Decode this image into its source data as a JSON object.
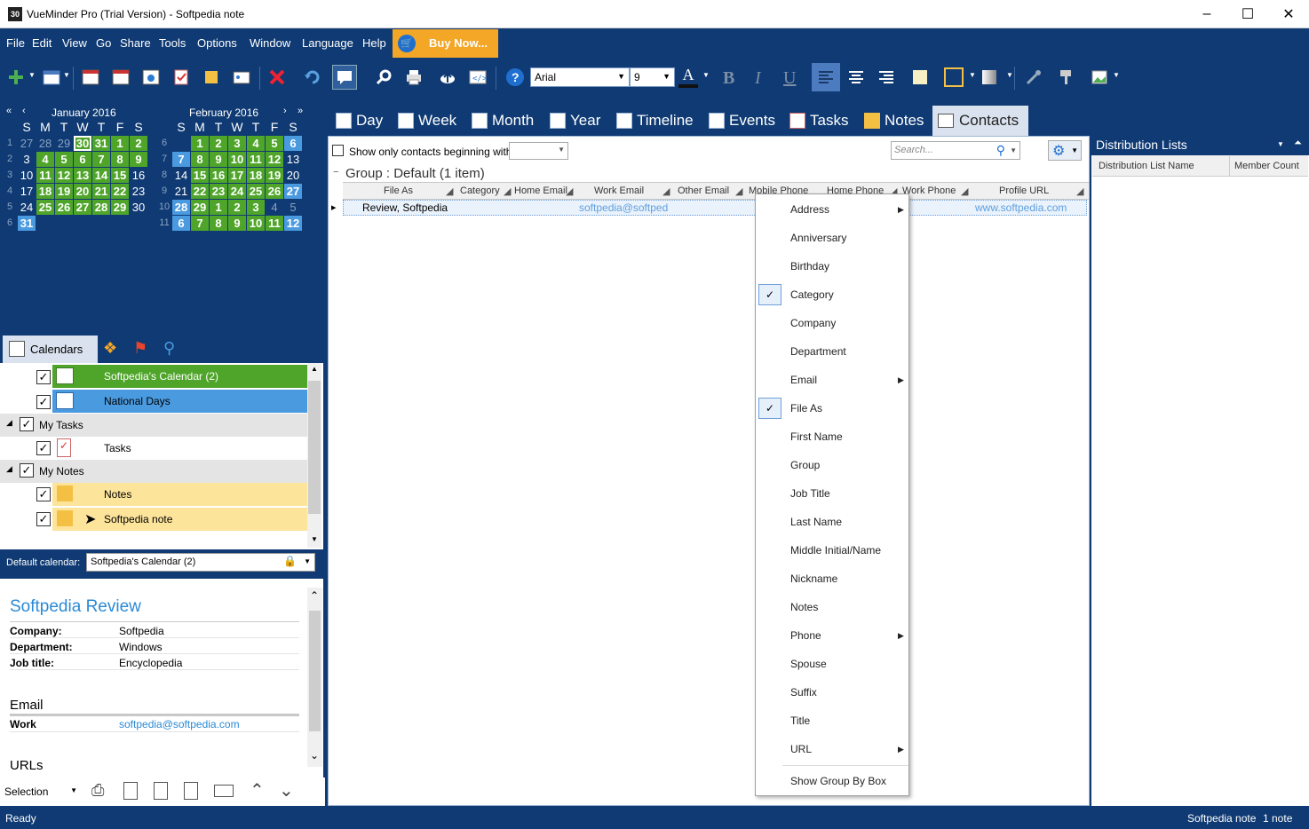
{
  "window": {
    "title": "VueMinder Pro (Trial Version) - Softpedia note",
    "app_icon_text": "30"
  },
  "menu": [
    "File",
    "Edit",
    "View",
    "Go",
    "Share",
    "Tools",
    "Options",
    "Window",
    "Language",
    "Help"
  ],
  "buy_now": "Buy Now...",
  "toolbar": {
    "font_name": "Arial",
    "font_size": "9"
  },
  "mini_calendars": [
    {
      "title": "January 2016",
      "dow": [
        "S",
        "M",
        "T",
        "W",
        "T",
        "F",
        "S"
      ],
      "weeks": [
        {
          "wk": "1",
          "days": [
            "27",
            "28",
            "29",
            "30",
            "31",
            "1",
            "2"
          ]
        },
        {
          "wk": "2",
          "days": [
            "3",
            "4",
            "5",
            "6",
            "7",
            "8",
            "9"
          ]
        },
        {
          "wk": "3",
          "days": [
            "10",
            "11",
            "12",
            "13",
            "14",
            "15",
            "16"
          ]
        },
        {
          "wk": "4",
          "days": [
            "17",
            "18",
            "19",
            "20",
            "21",
            "22",
            "23"
          ]
        },
        {
          "wk": "5",
          "days": [
            "24",
            "25",
            "26",
            "27",
            "28",
            "29",
            "30"
          ]
        },
        {
          "wk": "6",
          "days": [
            "31"
          ]
        }
      ]
    },
    {
      "title": "February 2016",
      "dow": [
        "S",
        "M",
        "T",
        "W",
        "T",
        "F",
        "S"
      ],
      "weeks": [
        {
          "wk": "6",
          "days": [
            "",
            "1",
            "2",
            "3",
            "4",
            "5",
            "6"
          ]
        },
        {
          "wk": "7",
          "days": [
            "7",
            "8",
            "9",
            "10",
            "11",
            "12",
            "13"
          ]
        },
        {
          "wk": "8",
          "days": [
            "14",
            "15",
            "16",
            "17",
            "18",
            "19",
            "20"
          ]
        },
        {
          "wk": "9",
          "days": [
            "21",
            "22",
            "23",
            "24",
            "25",
            "26",
            "27"
          ]
        },
        {
          "wk": "10",
          "days": [
            "28",
            "29",
            "1",
            "2",
            "3",
            "4",
            "5"
          ]
        },
        {
          "wk": "11",
          "days": [
            "6",
            "7",
            "8",
            "9",
            "10",
            "11",
            "12"
          ]
        }
      ]
    }
  ],
  "view_tabs": [
    "Day",
    "Week",
    "Month",
    "Year",
    "Timeline",
    "Events",
    "Tasks",
    "Notes",
    "Contacts"
  ],
  "filter": {
    "label": "Show only contacts beginning with:",
    "search_placeholder": "Search..."
  },
  "group_header": "Group : Default (1 item)",
  "columns": [
    "File As",
    "Category",
    "Home Email",
    "Work Email",
    "Other Email",
    "Mobile Phone",
    "Home Phone",
    "Work Phone",
    "Profile URL"
  ],
  "row": {
    "file_as": "Review, Softpedia",
    "work_email": "softpedia@softped",
    "profile_url": "www.softpedia.com"
  },
  "context_menu": [
    {
      "label": "Address",
      "sub": true,
      "checked": false
    },
    {
      "label": "Anniversary",
      "sub": false,
      "checked": false
    },
    {
      "label": "Birthday",
      "sub": false,
      "checked": false
    },
    {
      "label": "Category",
      "sub": false,
      "checked": true
    },
    {
      "label": "Company",
      "sub": false,
      "checked": false
    },
    {
      "label": "Department",
      "sub": false,
      "checked": false
    },
    {
      "label": "Email",
      "sub": true,
      "checked": false
    },
    {
      "label": "File As",
      "sub": false,
      "checked": true
    },
    {
      "label": "First Name",
      "sub": false,
      "checked": false
    },
    {
      "label": "Group",
      "sub": false,
      "checked": false
    },
    {
      "label": "Job Title",
      "sub": false,
      "checked": false
    },
    {
      "label": "Last Name",
      "sub": false,
      "checked": false
    },
    {
      "label": "Middle Initial/Name",
      "sub": false,
      "checked": false
    },
    {
      "label": "Nickname",
      "sub": false,
      "checked": false
    },
    {
      "label": "Notes",
      "sub": false,
      "checked": false
    },
    {
      "label": "Phone",
      "sub": true,
      "checked": false
    },
    {
      "label": "Spouse",
      "sub": false,
      "checked": false
    },
    {
      "label": "Suffix",
      "sub": false,
      "checked": false
    },
    {
      "label": "Title",
      "sub": false,
      "checked": false
    },
    {
      "label": "URL",
      "sub": true,
      "checked": false
    }
  ],
  "context_menu_footer": "Show Group By Box",
  "distribution": {
    "title": "Distribution Lists",
    "col1": "Distribution List Name",
    "col2": "Member Count"
  },
  "left_tabs": {
    "calendars": "Calendars"
  },
  "calendars": {
    "softpedia": "Softpedia's Calendar (2)",
    "national": "National Days",
    "my_tasks": "My Tasks",
    "tasks": "Tasks",
    "my_notes": "My Notes",
    "notes": "Notes",
    "softpedia_note": "Softpedia note"
  },
  "default_calendar": {
    "label": "Default calendar:",
    "value": "Softpedia's Calendar (2)"
  },
  "detail": {
    "name": "Softpedia Review",
    "fields": [
      {
        "k": "Company:",
        "v": "Softpedia"
      },
      {
        "k": "Department:",
        "v": "Windows"
      },
      {
        "k": "Job title:",
        "v": "Encyclopedia"
      }
    ],
    "email_header": "Email",
    "email_label": "Work",
    "email_value": "softpedia@softpedia.com",
    "urls_header": "URLs"
  },
  "bottom": {
    "selection": "Selection"
  },
  "status": {
    "left": "Ready",
    "item": "Softpedia note",
    "count": "1 note"
  },
  "colors": {
    "accent": "#0f3a73",
    "green": "#4fa52a",
    "blue": "#4a9ae0",
    "orange": "#f4a627",
    "notes": "#fde49b"
  }
}
